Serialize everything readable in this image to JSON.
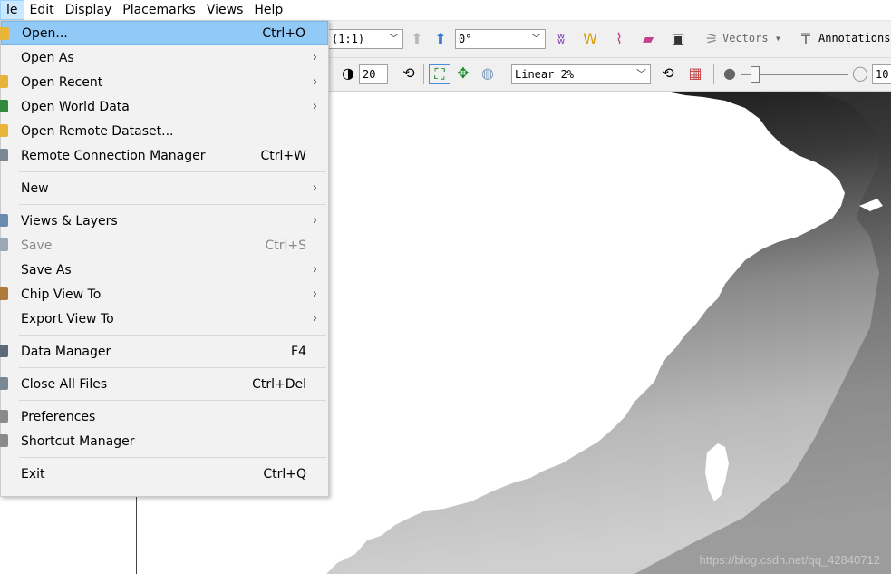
{
  "menubar": {
    "items": [
      {
        "label": "le",
        "active": true
      },
      {
        "label": "Edit"
      },
      {
        "label": "Display"
      },
      {
        "label": "Placemarks"
      },
      {
        "label": "Views"
      },
      {
        "label": "Help"
      }
    ]
  },
  "toolbar1": {
    "zoom_value": "(1:1)",
    "rotation_value": "0°",
    "vectors_label": "Vectors",
    "annotations_label": "Annotations"
  },
  "toolbar2": {
    "sharpen_value": "20",
    "stretch_value": "Linear 2%",
    "opacity_value": "10"
  },
  "file_menu": {
    "items": [
      {
        "label": "Open...",
        "shortcut": "Ctrl+O",
        "highlight": true,
        "icon": "folder-open-icon",
        "icon_color": "#e8b53a"
      },
      {
        "label": "Open As",
        "submenu": true
      },
      {
        "label": "Open Recent",
        "submenu": true,
        "icon": "folder-recent-icon",
        "icon_color": "#e8b53a"
      },
      {
        "label": "Open World Data",
        "submenu": true,
        "icon": "globe-icon",
        "icon_color": "#2f8a3c"
      },
      {
        "label": "Open Remote Dataset...",
        "icon": "folder-remote-icon",
        "icon_color": "#e8b53a"
      },
      {
        "label": "Remote Connection Manager",
        "shortcut": "Ctrl+W",
        "icon": "connection-icon",
        "icon_color": "#7a8896"
      },
      {
        "sep": true
      },
      {
        "label": "New",
        "submenu": true
      },
      {
        "sep": true
      },
      {
        "label": "Views & Layers",
        "submenu": true,
        "icon": "layers-icon",
        "icon_color": "#6c8bb0"
      },
      {
        "label": "Save",
        "shortcut": "Ctrl+S",
        "disabled": true,
        "icon": "save-icon",
        "icon_color": "#9aa7b5"
      },
      {
        "label": "Save As",
        "submenu": true
      },
      {
        "label": "Chip View To",
        "submenu": true,
        "icon": "chip-icon",
        "icon_color": "#b07a3a"
      },
      {
        "label": "Export View To",
        "submenu": true
      },
      {
        "sep": true
      },
      {
        "label": "Data Manager",
        "shortcut": "F4",
        "icon": "data-manager-icon",
        "icon_color": "#5a6a7a"
      },
      {
        "sep": true
      },
      {
        "label": "Close All Files",
        "shortcut": "Ctrl+Del",
        "icon": "close-files-icon",
        "icon_color": "#7a8896"
      },
      {
        "sep": true
      },
      {
        "label": "Preferences",
        "icon": "preferences-icon",
        "icon_color": "#8a8a8a"
      },
      {
        "label": "Shortcut Manager",
        "icon": "shortcut-icon",
        "icon_color": "#8a8a8a"
      },
      {
        "sep": true
      },
      {
        "label": "Exit",
        "shortcut": "Ctrl+Q"
      }
    ]
  },
  "watermark": "https://blog.csdn.net/qq_42840712"
}
